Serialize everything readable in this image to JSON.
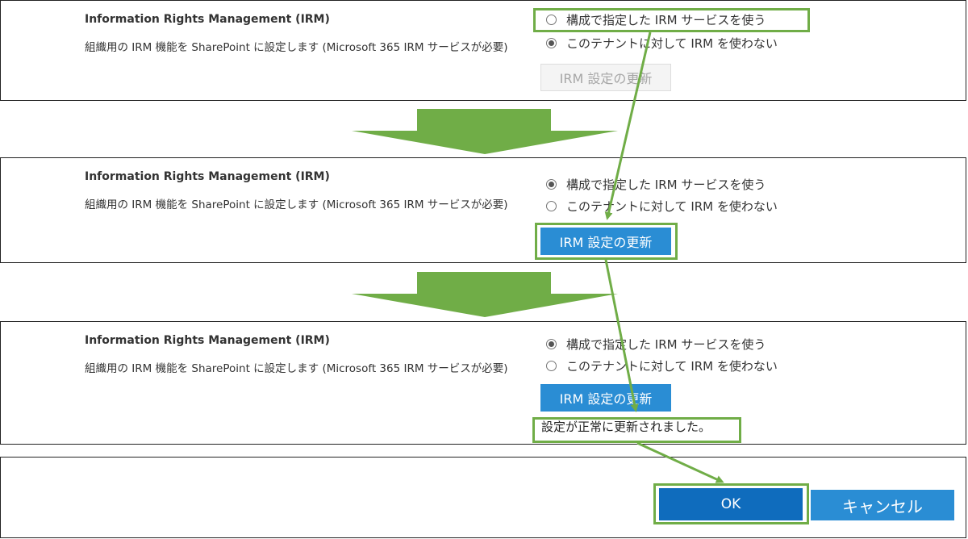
{
  "colors": {
    "highlight": "#70ad47",
    "arrow_fill": "#70ad47",
    "primary_button": "#2a8dd4",
    "ok_button": "#0f6cbd"
  },
  "panels": [
    {
      "title": "Information Rights Management (IRM)",
      "description": "組織用の IRM 機能を SharePoint に設定します (Microsoft 365 IRM サービスが必要)",
      "option_use_service": "構成で指定した IRM サービスを使う",
      "option_no_irm": "このテナントに対して IRM を使わない",
      "selected_option": "option_no_irm",
      "update_button": "IRM 設定の更新",
      "update_button_state": "disabled"
    },
    {
      "title": "Information Rights Management (IRM)",
      "description": "組織用の IRM 機能を SharePoint に設定します (Microsoft 365 IRM サービスが必要)",
      "option_use_service": "構成で指定した IRM サービスを使う",
      "option_no_irm": "このテナントに対して IRM を使わない",
      "selected_option": "option_use_service",
      "update_button": "IRM 設定の更新",
      "update_button_state": "enabled"
    },
    {
      "title": "Information Rights Management (IRM)",
      "description": "組織用の IRM 機能を SharePoint に設定します (Microsoft 365 IRM サービスが必要)",
      "option_use_service": "構成で指定した IRM サービスを使う",
      "option_no_irm": "このテナントに対して IRM を使わない",
      "selected_option": "option_use_service",
      "update_button": "IRM 設定の更新",
      "update_button_state": "enabled",
      "status_message": "設定が正常に更新されました。"
    }
  ],
  "footer": {
    "ok_label": "OK",
    "cancel_label": "キャンセル"
  },
  "icons": {
    "step_arrow": "down-arrow-icon",
    "connector": "connector-arrow-icon"
  }
}
